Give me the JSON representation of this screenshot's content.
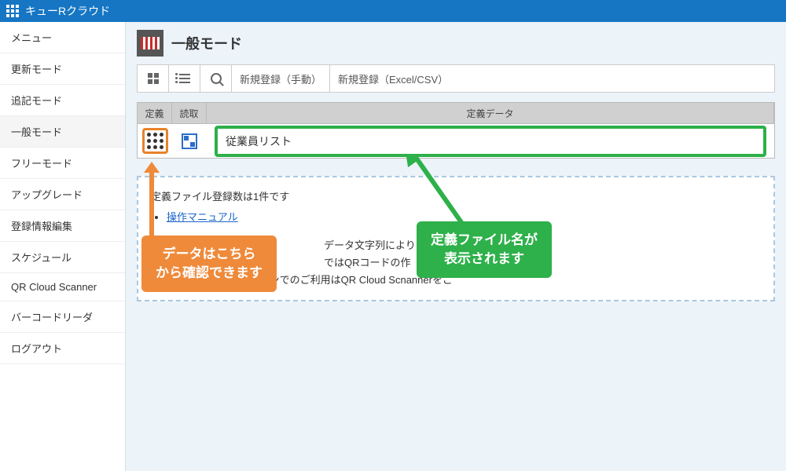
{
  "app": {
    "title": "キューRクラウド"
  },
  "sidebar": {
    "items": [
      {
        "label": "メニュー"
      },
      {
        "label": "更新モード"
      },
      {
        "label": "追記モード"
      },
      {
        "label": "一般モード"
      },
      {
        "label": "フリーモード"
      },
      {
        "label": "アップグレード"
      },
      {
        "label": "登録情報編集"
      },
      {
        "label": "スケジュール"
      },
      {
        "label": "QR Cloud Scanner"
      },
      {
        "label": "バーコードリーダ"
      },
      {
        "label": "ログアウト"
      }
    ]
  },
  "page": {
    "title": "一般モード"
  },
  "toolbar": {
    "new_manual": "新規登録（手動）",
    "new_excel": "新規登録（Excel/CSV）"
  },
  "table": {
    "head": {
      "def": "定義",
      "read": "読取",
      "data": "定義データ"
    },
    "row": {
      "data_name": "従業員リスト"
    }
  },
  "info": {
    "count_text": "定義ファイル登録数は1件です",
    "link": "操作マニュアル",
    "line2a": "データ文字列により",
    "line2b": "ではQRコードの作",
    "line3": "はスマートフォンでのご利用はQR Cloud Scnannerをご"
  },
  "callouts": {
    "orange_l1": "データはこちら",
    "orange_l2": "から確認できます",
    "green_l1": "定義ファイル名が",
    "green_l2": "表示されます"
  }
}
